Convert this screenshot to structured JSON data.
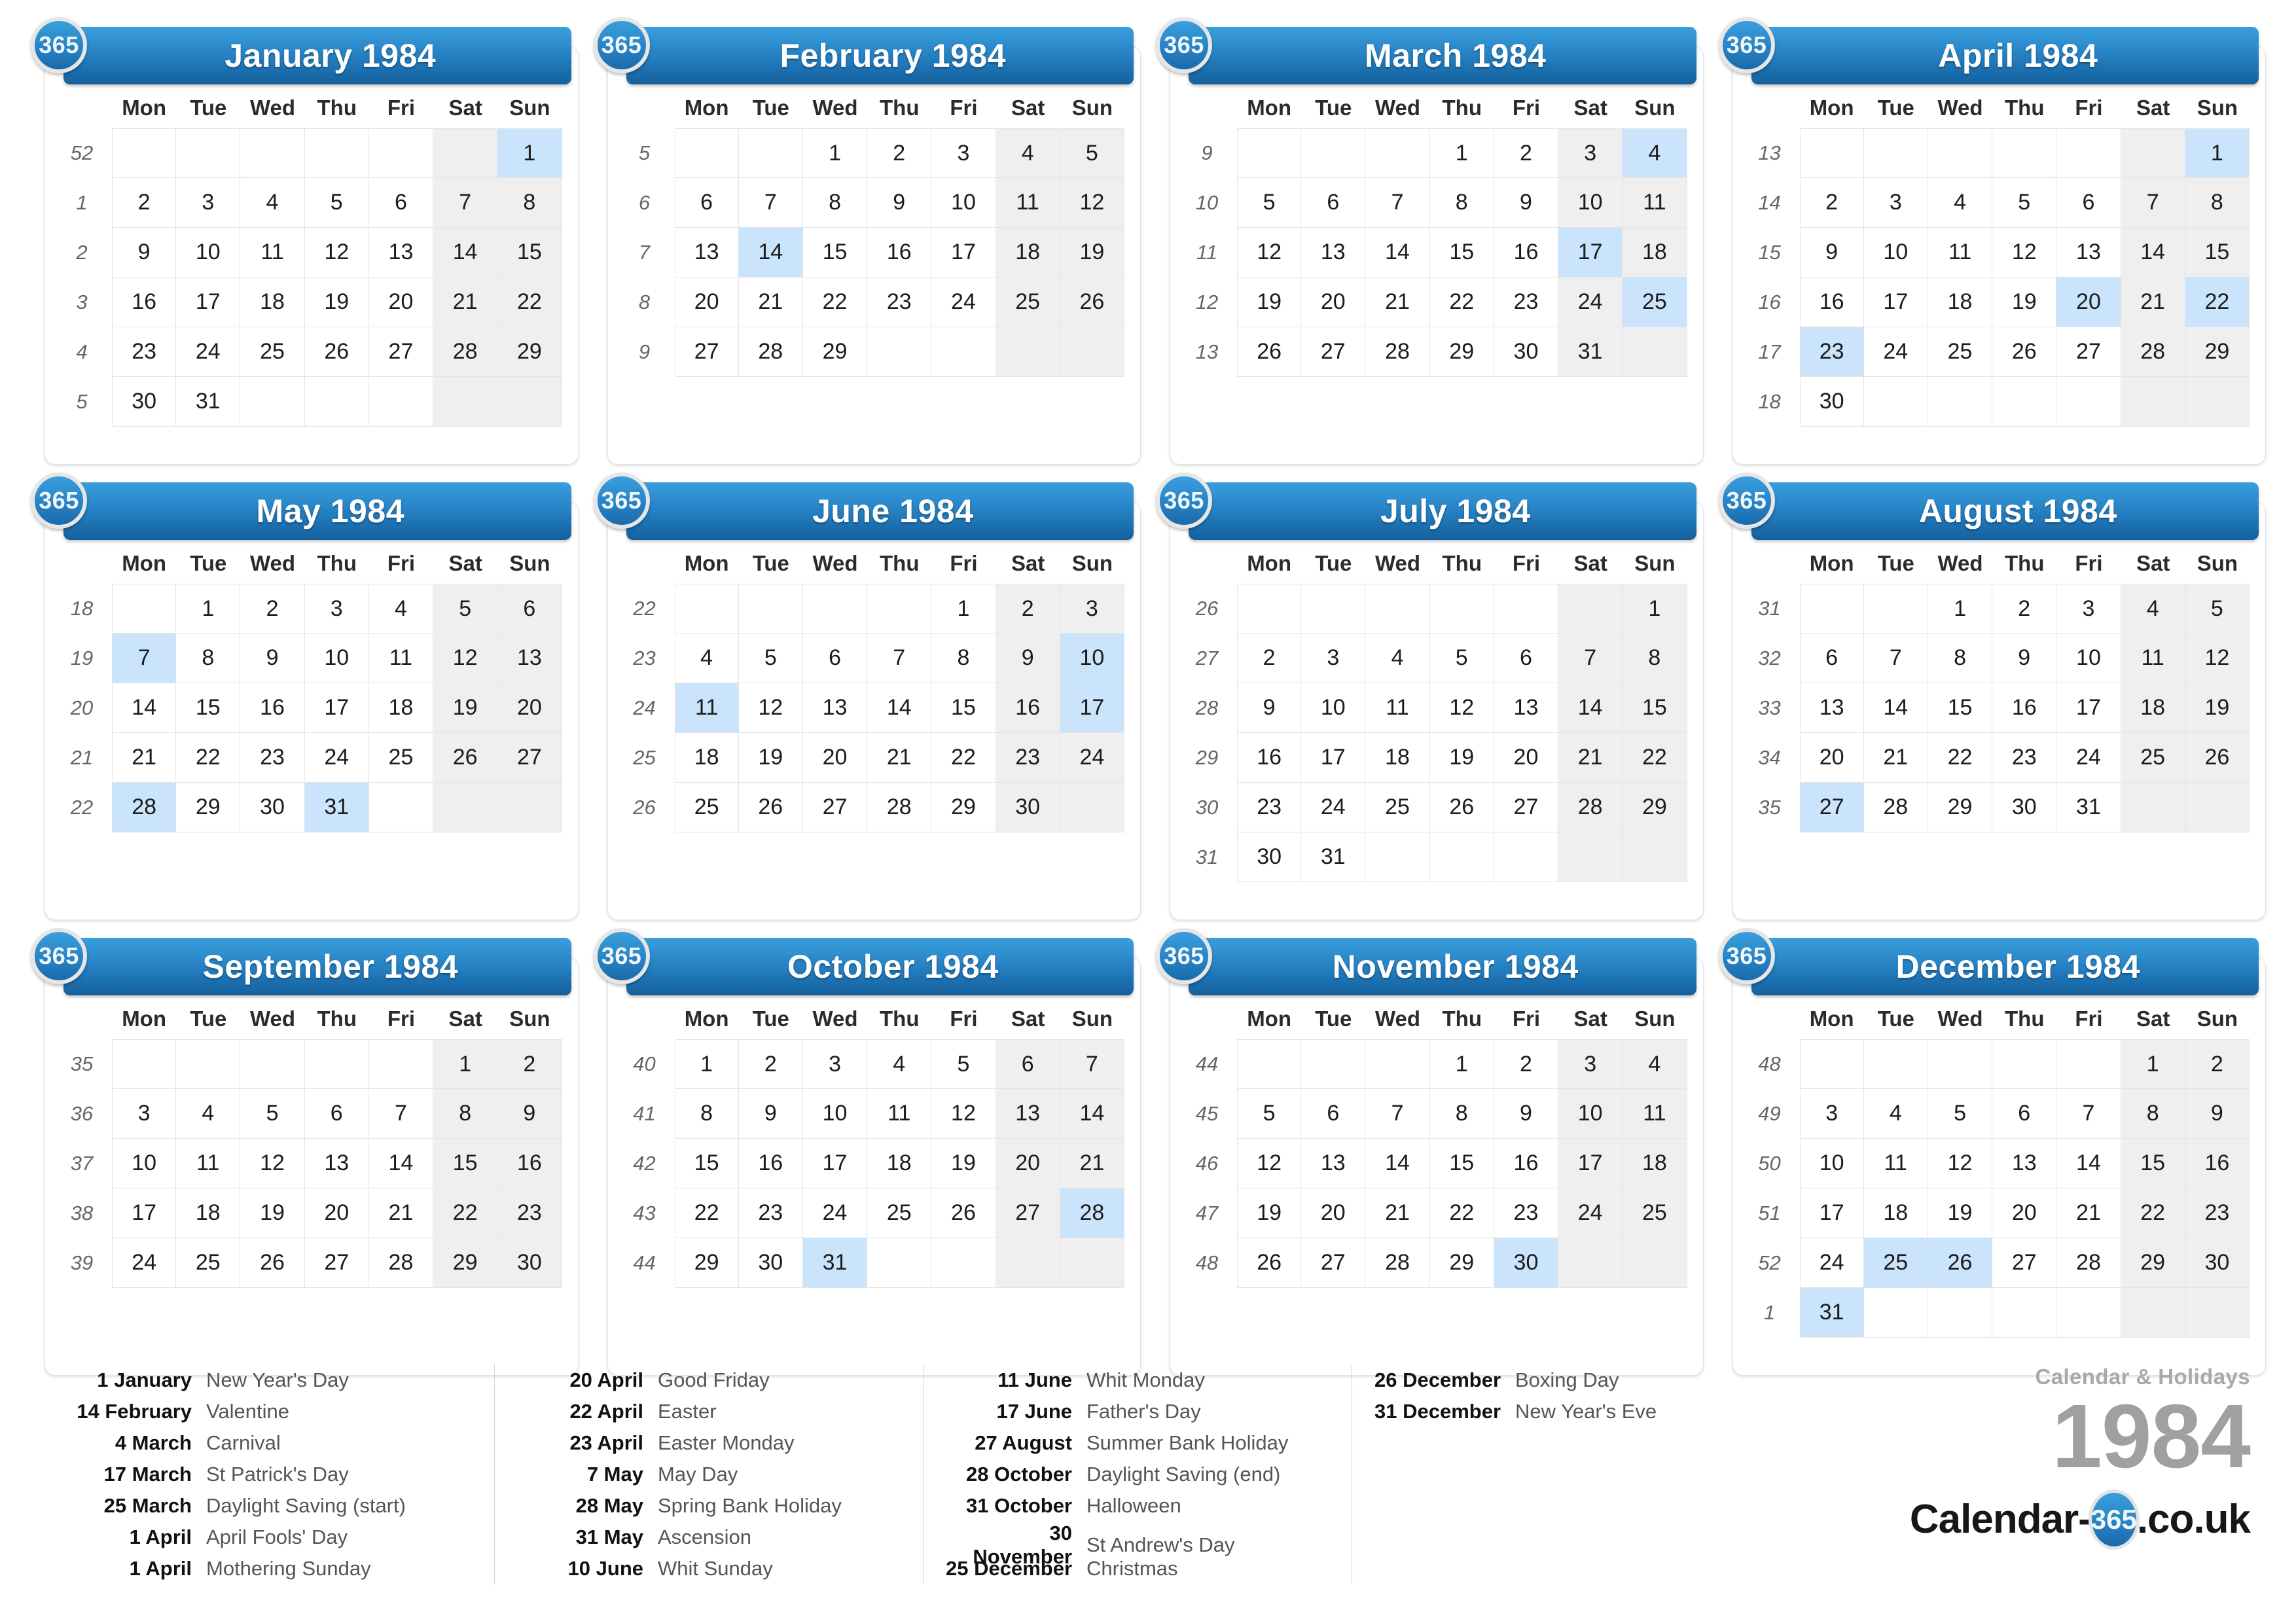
{
  "badge_label": "365",
  "weekday_headers": [
    "Mon",
    "Tue",
    "Wed",
    "Thu",
    "Fri",
    "Sat",
    "Sun"
  ],
  "colors": {
    "header_blue": "#2986c8",
    "highlight_blue": "#c9e4fb",
    "weekend_gray": "#efefef",
    "brand_gray": "#a0a0a0"
  },
  "months": [
    {
      "title": "January 1984",
      "weeks": [
        {
          "week": "52",
          "days": [
            "",
            "",
            "",
            "",
            "",
            "",
            "1"
          ],
          "highlight": [
            6
          ]
        },
        {
          "week": "1",
          "days": [
            "2",
            "3",
            "4",
            "5",
            "6",
            "7",
            "8"
          ],
          "highlight": []
        },
        {
          "week": "2",
          "days": [
            "9",
            "10",
            "11",
            "12",
            "13",
            "14",
            "15"
          ],
          "highlight": []
        },
        {
          "week": "3",
          "days": [
            "16",
            "17",
            "18",
            "19",
            "20",
            "21",
            "22"
          ],
          "highlight": []
        },
        {
          "week": "4",
          "days": [
            "23",
            "24",
            "25",
            "26",
            "27",
            "28",
            "29"
          ],
          "highlight": []
        },
        {
          "week": "5",
          "days": [
            "30",
            "31",
            "",
            "",
            "",
            "",
            ""
          ],
          "highlight": []
        }
      ]
    },
    {
      "title": "February 1984",
      "weeks": [
        {
          "week": "5",
          "days": [
            "",
            "",
            "1",
            "2",
            "3",
            "4",
            "5"
          ],
          "highlight": []
        },
        {
          "week": "6",
          "days": [
            "6",
            "7",
            "8",
            "9",
            "10",
            "11",
            "12"
          ],
          "highlight": []
        },
        {
          "week": "7",
          "days": [
            "13",
            "14",
            "15",
            "16",
            "17",
            "18",
            "19"
          ],
          "highlight": [
            1
          ]
        },
        {
          "week": "8",
          "days": [
            "20",
            "21",
            "22",
            "23",
            "24",
            "25",
            "26"
          ],
          "highlight": []
        },
        {
          "week": "9",
          "days": [
            "27",
            "28",
            "29",
            "",
            "",
            "",
            ""
          ],
          "highlight": []
        }
      ]
    },
    {
      "title": "March 1984",
      "weeks": [
        {
          "week": "9",
          "days": [
            "",
            "",
            "",
            "1",
            "2",
            "3",
            "4"
          ],
          "highlight": [
            6
          ]
        },
        {
          "week": "10",
          "days": [
            "5",
            "6",
            "7",
            "8",
            "9",
            "10",
            "11"
          ],
          "highlight": []
        },
        {
          "week": "11",
          "days": [
            "12",
            "13",
            "14",
            "15",
            "16",
            "17",
            "18"
          ],
          "highlight": [
            5
          ]
        },
        {
          "week": "12",
          "days": [
            "19",
            "20",
            "21",
            "22",
            "23",
            "24",
            "25"
          ],
          "highlight": [
            6
          ]
        },
        {
          "week": "13",
          "days": [
            "26",
            "27",
            "28",
            "29",
            "30",
            "31",
            ""
          ],
          "highlight": []
        }
      ]
    },
    {
      "title": "April 1984",
      "weeks": [
        {
          "week": "13",
          "days": [
            "",
            "",
            "",
            "",
            "",
            "",
            "1"
          ],
          "highlight": [
            6
          ]
        },
        {
          "week": "14",
          "days": [
            "2",
            "3",
            "4",
            "5",
            "6",
            "7",
            "8"
          ],
          "highlight": []
        },
        {
          "week": "15",
          "days": [
            "9",
            "10",
            "11",
            "12",
            "13",
            "14",
            "15"
          ],
          "highlight": []
        },
        {
          "week": "16",
          "days": [
            "16",
            "17",
            "18",
            "19",
            "20",
            "21",
            "22"
          ],
          "highlight": [
            4,
            6
          ]
        },
        {
          "week": "17",
          "days": [
            "23",
            "24",
            "25",
            "26",
            "27",
            "28",
            "29"
          ],
          "highlight": [
            0
          ]
        },
        {
          "week": "18",
          "days": [
            "30",
            "",
            "",
            "",
            "",
            "",
            ""
          ],
          "highlight": []
        }
      ]
    },
    {
      "title": "May 1984",
      "weeks": [
        {
          "week": "18",
          "days": [
            "",
            "1",
            "2",
            "3",
            "4",
            "5",
            "6"
          ],
          "highlight": []
        },
        {
          "week": "19",
          "days": [
            "7",
            "8",
            "9",
            "10",
            "11",
            "12",
            "13"
          ],
          "highlight": [
            0
          ]
        },
        {
          "week": "20",
          "days": [
            "14",
            "15",
            "16",
            "17",
            "18",
            "19",
            "20"
          ],
          "highlight": []
        },
        {
          "week": "21",
          "days": [
            "21",
            "22",
            "23",
            "24",
            "25",
            "26",
            "27"
          ],
          "highlight": []
        },
        {
          "week": "22",
          "days": [
            "28",
            "29",
            "30",
            "31",
            "",
            "",
            ""
          ],
          "highlight": [
            0,
            3
          ]
        }
      ]
    },
    {
      "title": "June 1984",
      "weeks": [
        {
          "week": "22",
          "days": [
            "",
            "",
            "",
            "",
            "1",
            "2",
            "3"
          ],
          "highlight": []
        },
        {
          "week": "23",
          "days": [
            "4",
            "5",
            "6",
            "7",
            "8",
            "9",
            "10"
          ],
          "highlight": [
            6
          ]
        },
        {
          "week": "24",
          "days": [
            "11",
            "12",
            "13",
            "14",
            "15",
            "16",
            "17"
          ],
          "highlight": [
            0,
            6
          ]
        },
        {
          "week": "25",
          "days": [
            "18",
            "19",
            "20",
            "21",
            "22",
            "23",
            "24"
          ],
          "highlight": []
        },
        {
          "week": "26",
          "days": [
            "25",
            "26",
            "27",
            "28",
            "29",
            "30",
            ""
          ],
          "highlight": []
        }
      ]
    },
    {
      "title": "July 1984",
      "weeks": [
        {
          "week": "26",
          "days": [
            "",
            "",
            "",
            "",
            "",
            "",
            "1"
          ],
          "highlight": []
        },
        {
          "week": "27",
          "days": [
            "2",
            "3",
            "4",
            "5",
            "6",
            "7",
            "8"
          ],
          "highlight": []
        },
        {
          "week": "28",
          "days": [
            "9",
            "10",
            "11",
            "12",
            "13",
            "14",
            "15"
          ],
          "highlight": []
        },
        {
          "week": "29",
          "days": [
            "16",
            "17",
            "18",
            "19",
            "20",
            "21",
            "22"
          ],
          "highlight": []
        },
        {
          "week": "30",
          "days": [
            "23",
            "24",
            "25",
            "26",
            "27",
            "28",
            "29"
          ],
          "highlight": []
        },
        {
          "week": "31",
          "days": [
            "30",
            "31",
            "",
            "",
            "",
            "",
            ""
          ],
          "highlight": []
        }
      ]
    },
    {
      "title": "August 1984",
      "weeks": [
        {
          "week": "31",
          "days": [
            "",
            "",
            "1",
            "2",
            "3",
            "4",
            "5"
          ],
          "highlight": []
        },
        {
          "week": "32",
          "days": [
            "6",
            "7",
            "8",
            "9",
            "10",
            "11",
            "12"
          ],
          "highlight": []
        },
        {
          "week": "33",
          "days": [
            "13",
            "14",
            "15",
            "16",
            "17",
            "18",
            "19"
          ],
          "highlight": []
        },
        {
          "week": "34",
          "days": [
            "20",
            "21",
            "22",
            "23",
            "24",
            "25",
            "26"
          ],
          "highlight": []
        },
        {
          "week": "35",
          "days": [
            "27",
            "28",
            "29",
            "30",
            "31",
            "",
            ""
          ],
          "highlight": [
            0
          ]
        }
      ]
    },
    {
      "title": "September 1984",
      "weeks": [
        {
          "week": "35",
          "days": [
            "",
            "",
            "",
            "",
            "",
            "1",
            "2"
          ],
          "highlight": []
        },
        {
          "week": "36",
          "days": [
            "3",
            "4",
            "5",
            "6",
            "7",
            "8",
            "9"
          ],
          "highlight": []
        },
        {
          "week": "37",
          "days": [
            "10",
            "11",
            "12",
            "13",
            "14",
            "15",
            "16"
          ],
          "highlight": []
        },
        {
          "week": "38",
          "days": [
            "17",
            "18",
            "19",
            "20",
            "21",
            "22",
            "23"
          ],
          "highlight": []
        },
        {
          "week": "39",
          "days": [
            "24",
            "25",
            "26",
            "27",
            "28",
            "29",
            "30"
          ],
          "highlight": []
        }
      ]
    },
    {
      "title": "October 1984",
      "weeks": [
        {
          "week": "40",
          "days": [
            "1",
            "2",
            "3",
            "4",
            "5",
            "6",
            "7"
          ],
          "highlight": []
        },
        {
          "week": "41",
          "days": [
            "8",
            "9",
            "10",
            "11",
            "12",
            "13",
            "14"
          ],
          "highlight": []
        },
        {
          "week": "42",
          "days": [
            "15",
            "16",
            "17",
            "18",
            "19",
            "20",
            "21"
          ],
          "highlight": []
        },
        {
          "week": "43",
          "days": [
            "22",
            "23",
            "24",
            "25",
            "26",
            "27",
            "28"
          ],
          "highlight": [
            6
          ]
        },
        {
          "week": "44",
          "days": [
            "29",
            "30",
            "31",
            "",
            "",
            "",
            ""
          ],
          "highlight": [
            2
          ]
        }
      ]
    },
    {
      "title": "November 1984",
      "weeks": [
        {
          "week": "44",
          "days": [
            "",
            "",
            "",
            "1",
            "2",
            "3",
            "4"
          ],
          "highlight": []
        },
        {
          "week": "45",
          "days": [
            "5",
            "6",
            "7",
            "8",
            "9",
            "10",
            "11"
          ],
          "highlight": []
        },
        {
          "week": "46",
          "days": [
            "12",
            "13",
            "14",
            "15",
            "16",
            "17",
            "18"
          ],
          "highlight": []
        },
        {
          "week": "47",
          "days": [
            "19",
            "20",
            "21",
            "22",
            "23",
            "24",
            "25"
          ],
          "highlight": []
        },
        {
          "week": "48",
          "days": [
            "26",
            "27",
            "28",
            "29",
            "30",
            "",
            ""
          ],
          "highlight": [
            4
          ]
        }
      ]
    },
    {
      "title": "December 1984",
      "weeks": [
        {
          "week": "48",
          "days": [
            "",
            "",
            "",
            "",
            "",
            "1",
            "2"
          ],
          "highlight": []
        },
        {
          "week": "49",
          "days": [
            "3",
            "4",
            "5",
            "6",
            "7",
            "8",
            "9"
          ],
          "highlight": []
        },
        {
          "week": "50",
          "days": [
            "10",
            "11",
            "12",
            "13",
            "14",
            "15",
            "16"
          ],
          "highlight": []
        },
        {
          "week": "51",
          "days": [
            "17",
            "18",
            "19",
            "20",
            "21",
            "22",
            "23"
          ],
          "highlight": []
        },
        {
          "week": "52",
          "days": [
            "24",
            "25",
            "26",
            "27",
            "28",
            "29",
            "30"
          ],
          "highlight": [
            1,
            2
          ]
        },
        {
          "week": "1",
          "days": [
            "31",
            "",
            "",
            "",
            "",
            "",
            ""
          ],
          "highlight": [
            0
          ]
        }
      ]
    }
  ],
  "legend": [
    [
      {
        "date": "1 January",
        "name": "New Year's Day"
      },
      {
        "date": "14 February",
        "name": "Valentine"
      },
      {
        "date": "4 March",
        "name": "Carnival"
      },
      {
        "date": "17 March",
        "name": "St Patrick's Day"
      },
      {
        "date": "25 March",
        "name": "Daylight Saving (start)"
      },
      {
        "date": "1 April",
        "name": "April Fools' Day"
      },
      {
        "date": "1 April",
        "name": "Mothering Sunday"
      }
    ],
    [
      {
        "date": "20 April",
        "name": "Good Friday"
      },
      {
        "date": "22 April",
        "name": "Easter"
      },
      {
        "date": "23 April",
        "name": "Easter Monday"
      },
      {
        "date": "7 May",
        "name": "May Day"
      },
      {
        "date": "28 May",
        "name": "Spring Bank Holiday"
      },
      {
        "date": "31 May",
        "name": "Ascension"
      },
      {
        "date": "10 June",
        "name": "Whit Sunday"
      }
    ],
    [
      {
        "date": "11 June",
        "name": "Whit Monday"
      },
      {
        "date": "17 June",
        "name": "Father's Day"
      },
      {
        "date": "27 August",
        "name": "Summer Bank Holiday"
      },
      {
        "date": "28 October",
        "name": "Daylight Saving (end)"
      },
      {
        "date": "31 October",
        "name": "Halloween"
      },
      {
        "date": "30 November",
        "name": "St Andrew's Day"
      },
      {
        "date": "25 December",
        "name": "Christmas"
      }
    ],
    [
      {
        "date": "26 December",
        "name": "Boxing Day"
      },
      {
        "date": "31 December",
        "name": "New Year's Eve"
      }
    ]
  ],
  "branding": {
    "subtitle": "Calendar & Holidays",
    "year": "1984",
    "logo_prefix": "Calendar-",
    "logo_badge": "365",
    "logo_suffix": ".co.uk"
  }
}
